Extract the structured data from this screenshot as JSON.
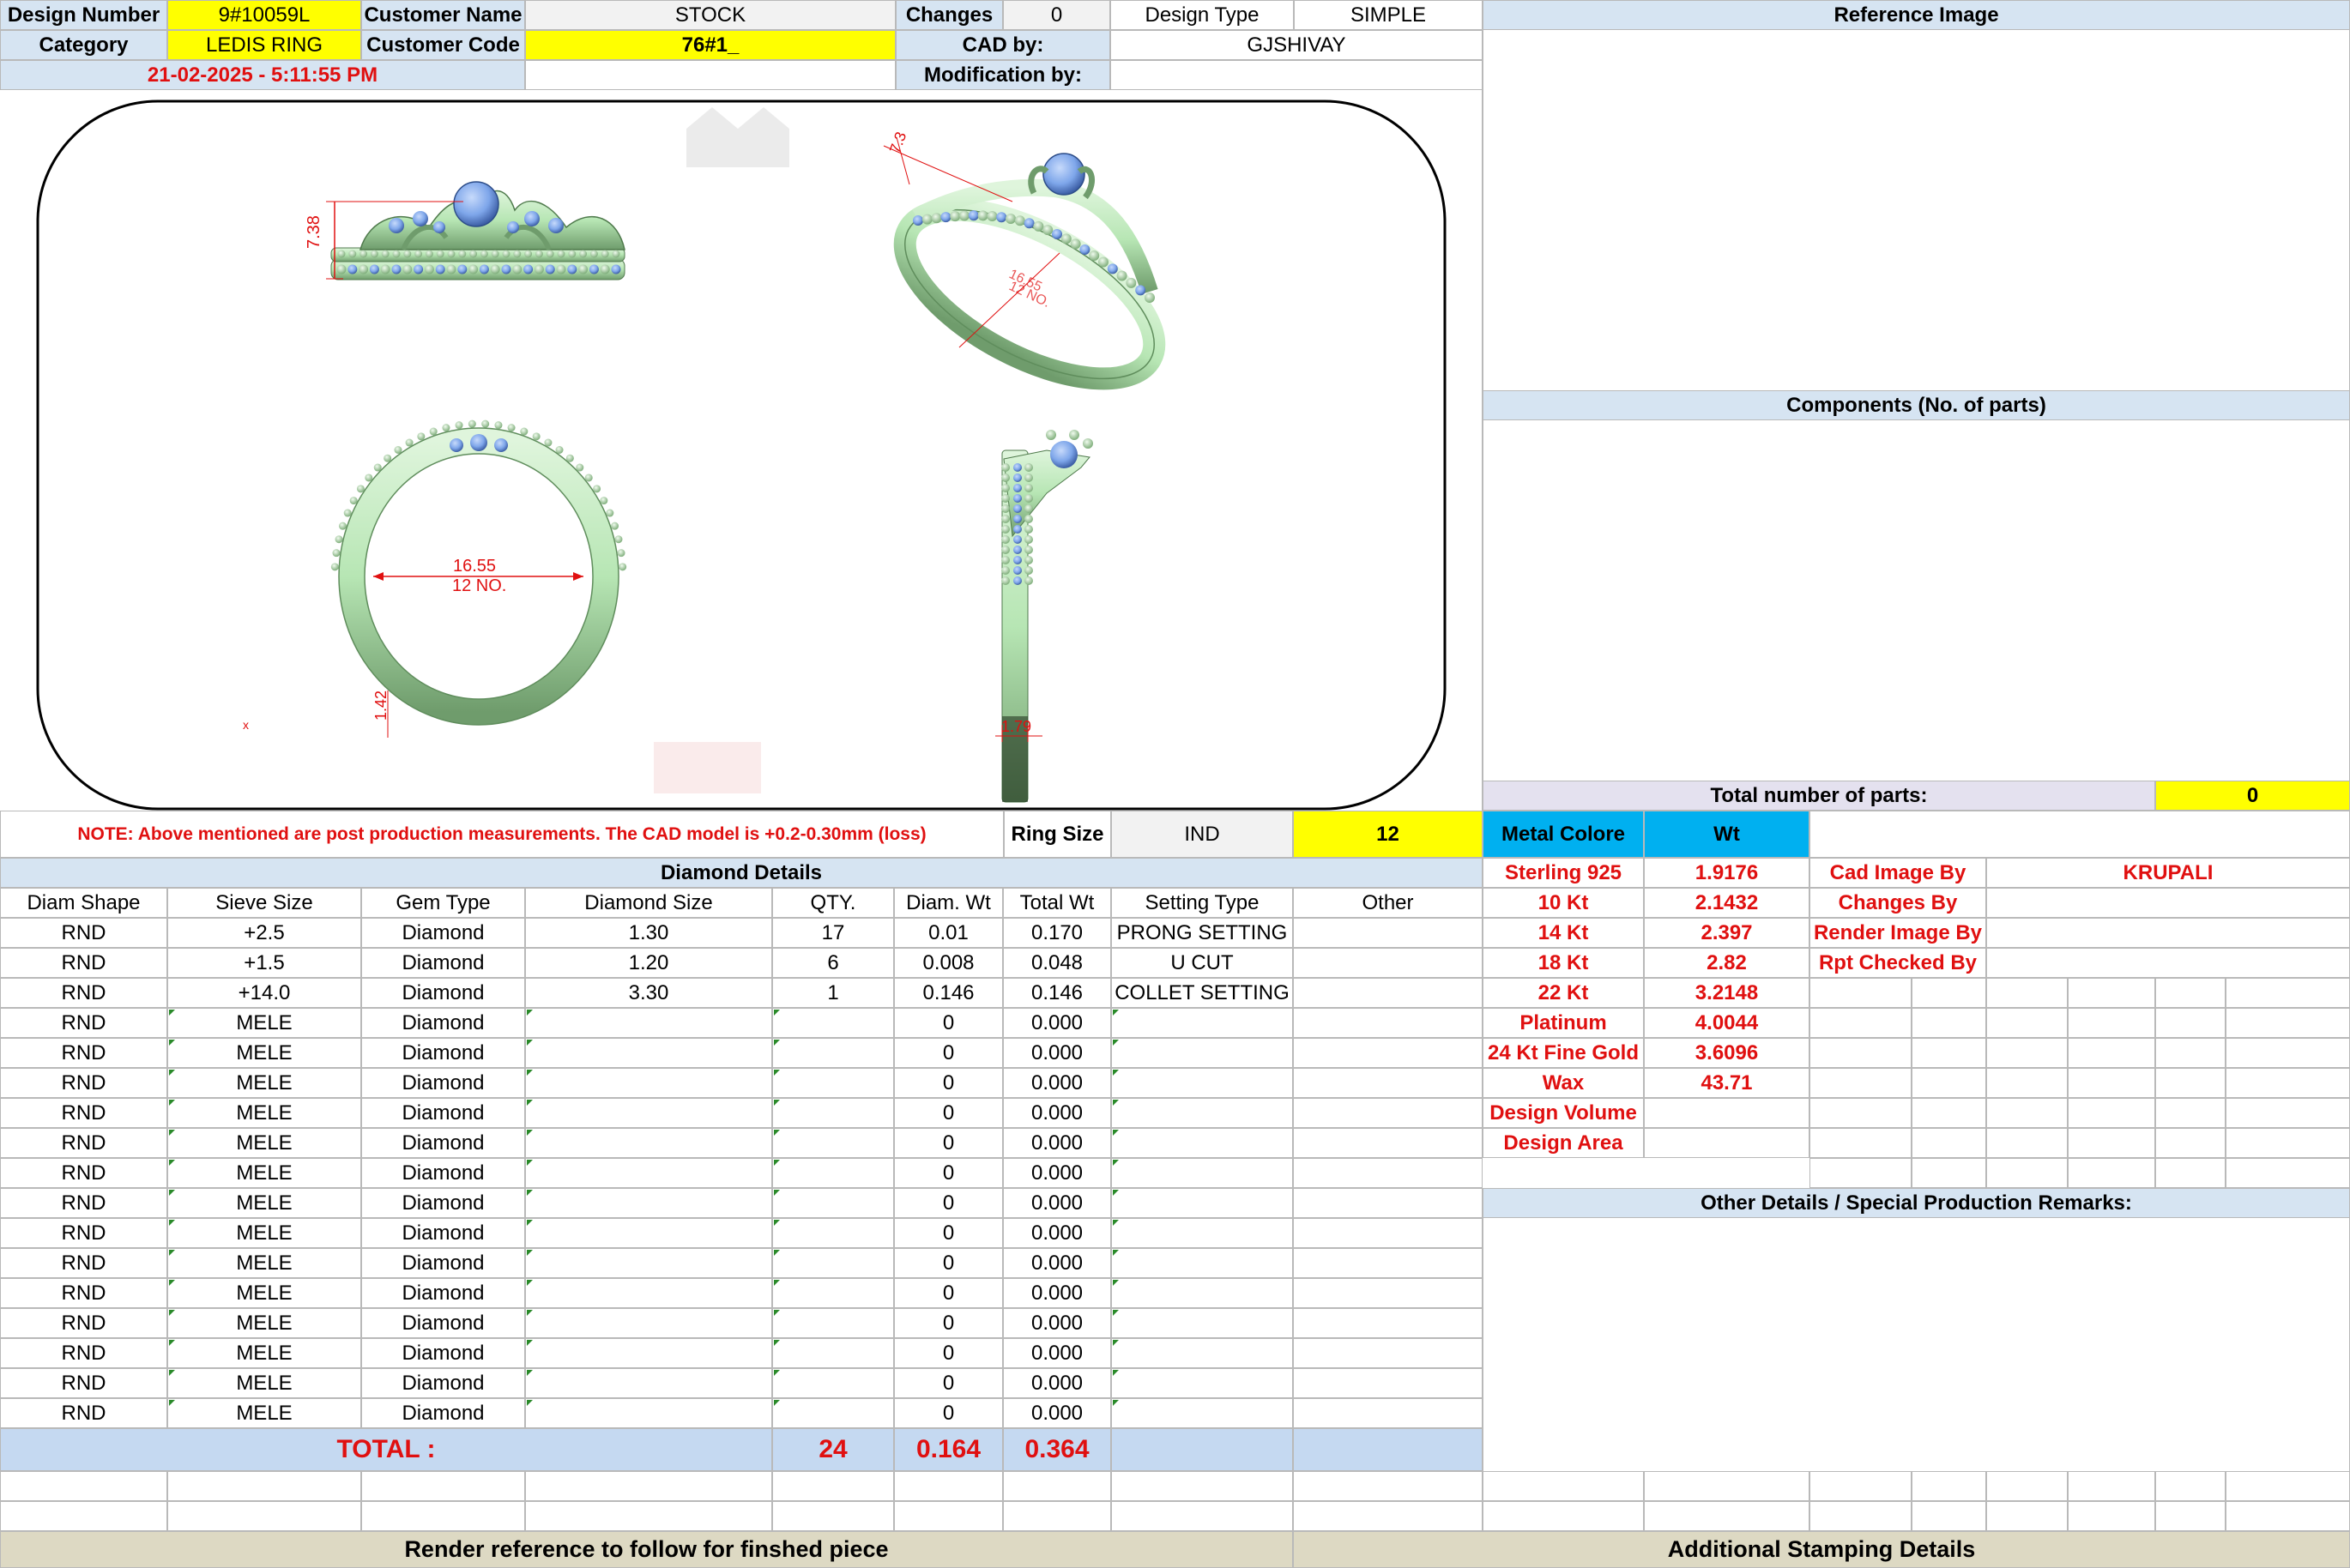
{
  "header": {
    "design_number_label": "Design Number",
    "design_number": "9#10059L",
    "customer_name_label": "Customer Name",
    "customer_name": "STOCK",
    "changes_label": "Changes",
    "changes": "0",
    "design_type_label": "Design Type",
    "design_type": "SIMPLE",
    "reference_image_label": "Reference Image",
    "category_label": "Category",
    "category": "LEDIS RING",
    "customer_code_label": "Customer Code",
    "customer_code": "76#1_",
    "cad_by_label": "CAD by:",
    "cad_by": "GJSHIVAY",
    "date": "21-02-2025 - 5:11:55 PM",
    "modification_by_label": "Modification by:"
  },
  "drawing": {
    "height_dim": "7.38",
    "top_dim": "7.3",
    "diameter_dim": "16.55",
    "size_no": "12 NO.",
    "thickness_dim": "1.42",
    "width_dim": "1.79",
    "marker": "x"
  },
  "right_panel": {
    "components_label": "Components (No. of parts)",
    "total_parts_label": "Total number of parts:",
    "total_parts": "0"
  },
  "note": "NOTE: Above mentioned are post production measurements. The CAD model is +0.2-0.30mm (loss)",
  "ring": {
    "label": "Ring Size",
    "standard": "IND",
    "size": "12"
  },
  "metal": {
    "label": "Metal Colore",
    "wt_label": "Wt",
    "rows": [
      {
        "name": "Sterling 925",
        "wt": "1.9176"
      },
      {
        "name": "10 Kt",
        "wt": "2.1432"
      },
      {
        "name": "14 Kt",
        "wt": "2.397"
      },
      {
        "name": "18 Kt",
        "wt": "2.82"
      },
      {
        "name": "22 Kt",
        "wt": "3.2148"
      },
      {
        "name": "Platinum",
        "wt": "4.0044"
      },
      {
        "name": "24 Kt Fine Gold",
        "wt": "3.6096"
      },
      {
        "name": "Wax",
        "wt": "43.71"
      },
      {
        "name": "Design Volume",
        "wt": ""
      },
      {
        "name": "Design Area",
        "wt": ""
      }
    ]
  },
  "roles": {
    "cad_image_by_label": "Cad Image By",
    "cad_image_by": "KRUPALI",
    "changes_by_label": "Changes By",
    "render_image_by_label": "Render Image By",
    "rpt_checked_by_label": "Rpt Checked By"
  },
  "other_details_label": "Other Details / Special Production Remarks:",
  "diamond": {
    "title": "Diamond Details",
    "columns": [
      "Diam Shape",
      "Sieve Size",
      "Gem Type",
      "Diamond Size",
      "QTY.",
      "Diam. Wt",
      "Total Wt",
      "Setting Type",
      "Other"
    ],
    "rows": [
      [
        "RND",
        "+2.5",
        "Diamond",
        "1.30",
        "17",
        "0.01",
        "0.170",
        "PRONG SETTING",
        ""
      ],
      [
        "RND",
        "+1.5",
        "Diamond",
        "1.20",
        "6",
        "0.008",
        "0.048",
        "U CUT",
        ""
      ],
      [
        "RND",
        "+14.0",
        "Diamond",
        "3.30",
        "1",
        "0.146",
        "0.146",
        "COLLET SETTING",
        ""
      ],
      [
        "RND",
        "MELE",
        "Diamond",
        "",
        "",
        "0",
        "0.000",
        "",
        ""
      ],
      [
        "RND",
        "MELE",
        "Diamond",
        "",
        "",
        "0",
        "0.000",
        "",
        ""
      ],
      [
        "RND",
        "MELE",
        "Diamond",
        "",
        "",
        "0",
        "0.000",
        "",
        ""
      ],
      [
        "RND",
        "MELE",
        "Diamond",
        "",
        "",
        "0",
        "0.000",
        "",
        ""
      ],
      [
        "RND",
        "MELE",
        "Diamond",
        "",
        "",
        "0",
        "0.000",
        "",
        ""
      ],
      [
        "RND",
        "MELE",
        "Diamond",
        "",
        "",
        "0",
        "0.000",
        "",
        ""
      ],
      [
        "RND",
        "MELE",
        "Diamond",
        "",
        "",
        "0",
        "0.000",
        "",
        ""
      ],
      [
        "RND",
        "MELE",
        "Diamond",
        "",
        "",
        "0",
        "0.000",
        "",
        ""
      ],
      [
        "RND",
        "MELE",
        "Diamond",
        "",
        "",
        "0",
        "0.000",
        "",
        ""
      ],
      [
        "RND",
        "MELE",
        "Diamond",
        "",
        "",
        "0",
        "0.000",
        "",
        ""
      ],
      [
        "RND",
        "MELE",
        "Diamond",
        "",
        "",
        "0",
        "0.000",
        "",
        ""
      ],
      [
        "RND",
        "MELE",
        "Diamond",
        "",
        "",
        "0",
        "0.000",
        "",
        ""
      ],
      [
        "RND",
        "MELE",
        "Diamond",
        "",
        "",
        "0",
        "0.000",
        "",
        ""
      ],
      [
        "RND",
        "MELE",
        "Diamond",
        "",
        "",
        "0",
        "0.000",
        "",
        ""
      ]
    ],
    "total_label": "TOTAL :",
    "total_qty": "24",
    "total_diam_wt": "0.164",
    "total_wt": "0.364"
  },
  "footer": {
    "render_reference": "Render reference to follow for finshed piece",
    "stamping": "Additional Stamping Details"
  },
  "colors": {
    "header_blue": "#d6e4f2",
    "highlight_yellow": "#ffff00",
    "metal_blue": "#00b0f0",
    "total_blue": "#c5d9f1",
    "footer_tan": "#ddd9c3",
    "ring_green": "#b7e6b4",
    "stone_blue": "#7ea6ea",
    "dimension_red": "#e01010"
  }
}
